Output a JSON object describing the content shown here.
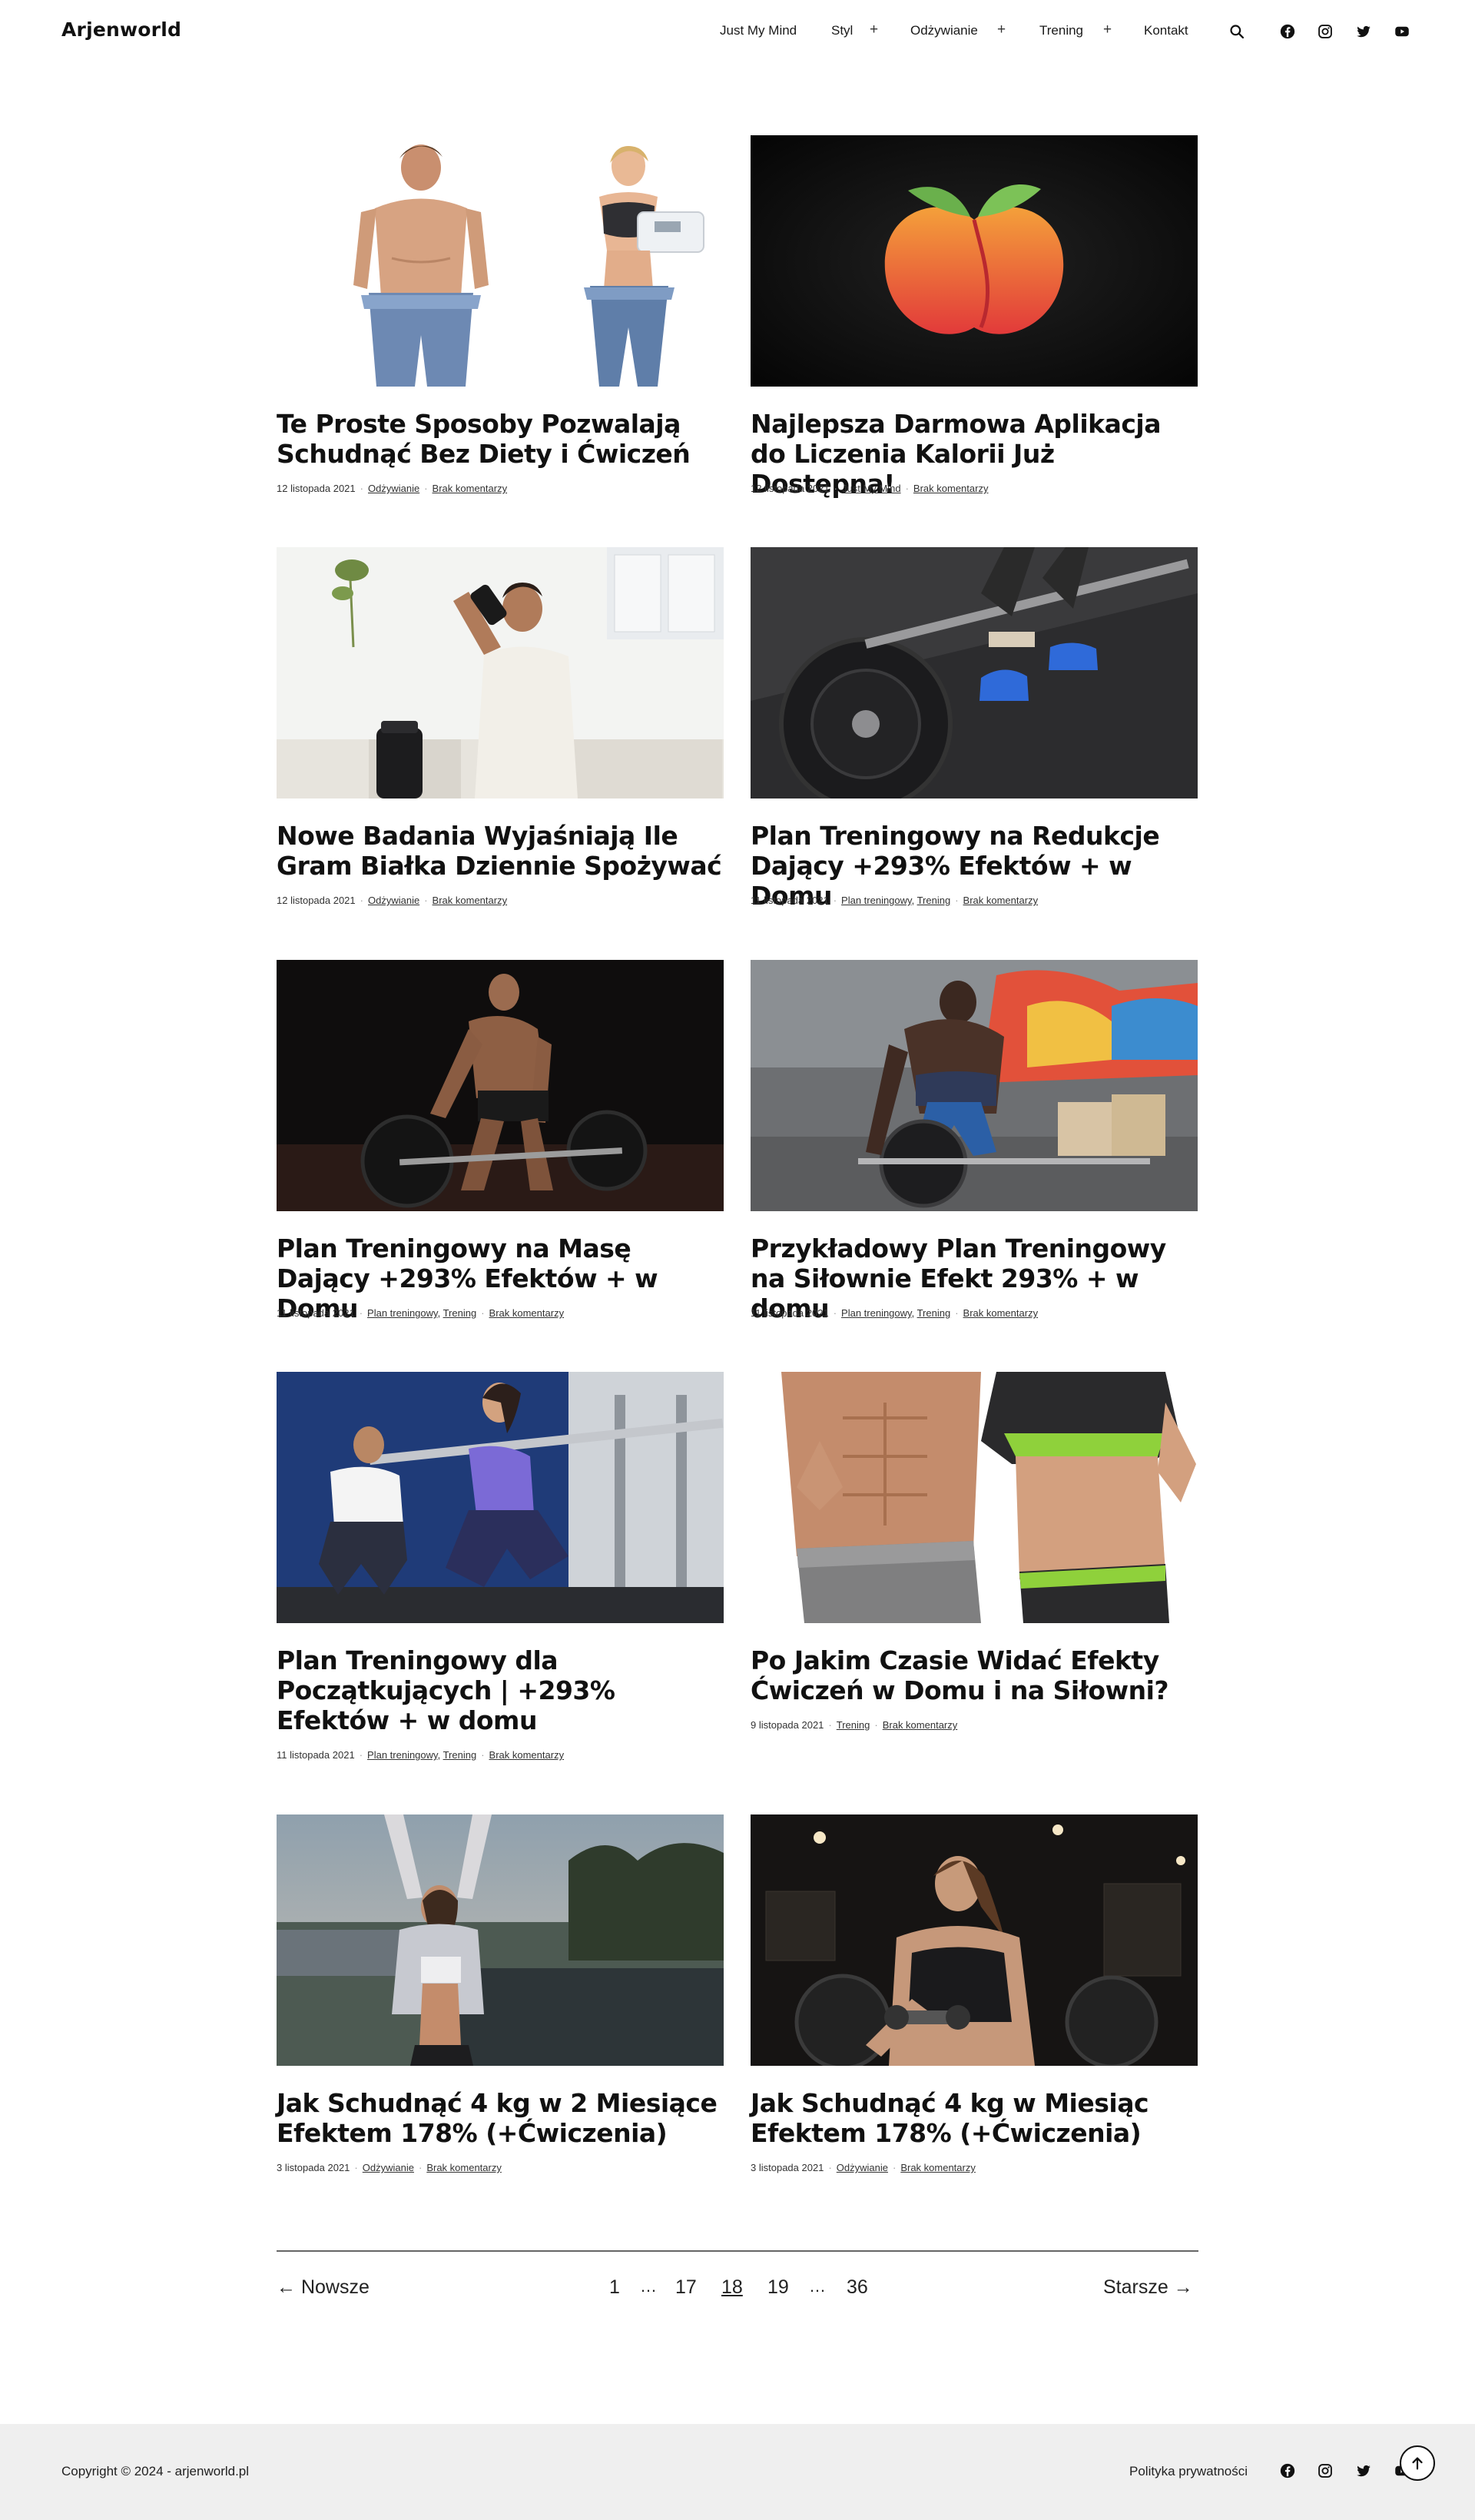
{
  "header": {
    "logo": "Arjenworld",
    "nav": [
      {
        "label": "Just My Mind",
        "has_submenu": false
      },
      {
        "label": "Styl",
        "has_submenu": true
      },
      {
        "label": "Odżywianie",
        "has_submenu": true
      },
      {
        "label": "Trening",
        "has_submenu": true
      },
      {
        "label": "Kontakt",
        "has_submenu": false
      }
    ],
    "submenu_symbol": "+",
    "icons": [
      "search-icon",
      "facebook-icon",
      "instagram-icon",
      "twitter-icon",
      "youtube-icon"
    ]
  },
  "posts": [
    {
      "title": "Te Proste Sposoby Pozwalają Schudnąć Bez Diety i Ćwiczeń",
      "date": "12 listopada 2021",
      "categories": [
        "Odżywianie"
      ],
      "comments": "Brak komentarzy",
      "image": "weight-loss-couple-image"
    },
    {
      "title": "Najlepsza Darmowa Aplikacja do Liczenia Kalorii Już Dostępna!",
      "date": "12 listopada 2021",
      "categories": [
        "Just My Mind"
      ],
      "comments": "Brak komentarzy",
      "image": "peach-app-logo-image"
    },
    {
      "title": "Nowe Badania Wyjaśniają Ile Gram Białka Dziennie Spożywać",
      "date": "12 listopada 2021",
      "categories": [
        "Odżywianie"
      ],
      "comments": "Brak komentarzy",
      "image": "man-drinking-shaker-image"
    },
    {
      "title": "Plan Treningowy na Redukcje Dający +293% Efektów + w Domu",
      "date": "11 listopada 2021",
      "categories": [
        "Plan treningowy",
        "Trening"
      ],
      "comments": "Brak komentarzy",
      "image": "barbell-deadlift-image"
    },
    {
      "title": "Plan Treningowy na Masę Dający +293% Efektów + w Domu",
      "date": "11 listopada 2021",
      "categories": [
        "Plan treningowy",
        "Trening"
      ],
      "comments": "Brak komentarzy",
      "image": "dark-gym-deadlift-image"
    },
    {
      "title": "Przykładowy Plan Treningowy na Siłownie Efekt 293% + w domu",
      "date": "11 listopada 2021",
      "categories": [
        "Plan treningowy",
        "Trening"
      ],
      "comments": "Brak komentarzy",
      "image": "gym-barbell-lift-image"
    },
    {
      "title": "Plan Treningowy dla Początkujących | +293% Efektów + w domu",
      "date": "11 listopada 2021",
      "categories": [
        "Plan treningowy",
        "Trening"
      ],
      "comments": "Brak komentarzy",
      "image": "trainer-squat-image"
    },
    {
      "title": "Po Jakim Czasie Widać Efekty Ćwiczeń w Domu i na Siłowni?",
      "date": "9 listopada 2021",
      "categories": [
        "Trening"
      ],
      "comments": "Brak komentarzy",
      "image": "abs-couple-image"
    },
    {
      "title": "Jak Schudnąć 4 kg w 2 Miesiące Efektem 178% (+Ćwiczenia)",
      "date": "3 listopada 2021",
      "categories": [
        "Odżywianie"
      ],
      "comments": "Brak komentarzy",
      "image": "woman-stretching-outdoor-image"
    },
    {
      "title": "Jak Schudnąć 4 kg w Miesiąc Efektem 178% (+Ćwiczenia)",
      "date": "3 listopada 2021",
      "categories": [
        "Odżywianie"
      ],
      "comments": "Brak komentarzy",
      "image": "woman-dumbbell-curl-image"
    }
  ],
  "pagination": {
    "prev": "Nowsze",
    "next": "Starsze",
    "pages": [
      "1",
      "17",
      "18",
      "19",
      "36"
    ],
    "current": "18",
    "dots": "…"
  },
  "footer": {
    "copyright": "Copyright © 2024 - arjenworld.pl",
    "privacy": "Polityka prywatności",
    "icons": [
      "facebook-icon",
      "instagram-icon",
      "twitter-icon",
      "youtube-icon"
    ],
    "back_to_top_icon": "arrow-up-icon"
  }
}
